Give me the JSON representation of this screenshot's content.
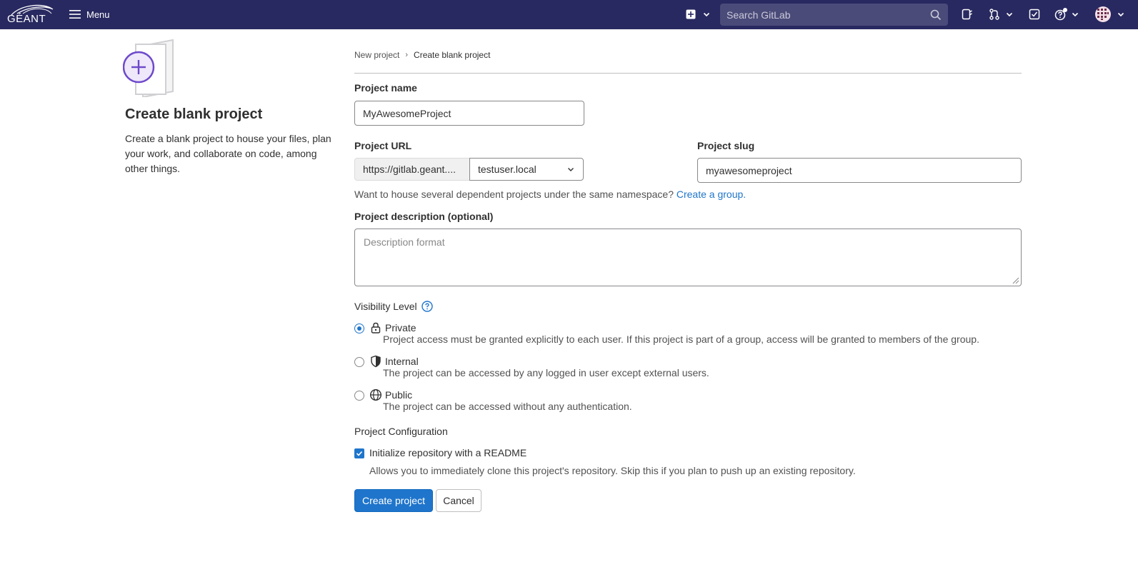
{
  "navbar": {
    "logo_text": "GÉANT",
    "menu_label": "Menu",
    "search_placeholder": "Search GitLab",
    "icons": [
      "plus-square-icon",
      "search-icon",
      "issues-icon",
      "merge-request-icon",
      "todo-icon",
      "help-icon",
      "avatar"
    ]
  },
  "left": {
    "title": "Create blank project",
    "description": "Create a blank project to house your files, plan your work, and collaborate on code, among other things."
  },
  "breadcrumb": {
    "parent": "New project",
    "separator": "›",
    "current": "Create blank project"
  },
  "form": {
    "project_name_label": "Project name",
    "project_name_value": "MyAwesomeProject",
    "project_url_label": "Project URL",
    "url_prefix": "https://gitlab.geant....",
    "namespace": "testuser.local",
    "project_slug_label": "Project slug",
    "project_slug_value": "myawesomeproject",
    "namespace_help_prefix": "Want to house several dependent projects under the same namespace? ",
    "namespace_help_link": "Create a group.",
    "description_label": "Project description (optional)",
    "description_placeholder": "Description format",
    "visibility_label": "Visibility Level",
    "visibility": [
      {
        "name": "Private",
        "desc": "Project access must be granted explicitly to each user. If this project is part of a group, access will be granted to members of the group.",
        "icon": "lock-icon",
        "checked": true
      },
      {
        "name": "Internal",
        "desc": "The project can be accessed by any logged in user except external users.",
        "icon": "shield-icon",
        "checked": false
      },
      {
        "name": "Public",
        "desc": "The project can be accessed without any authentication.",
        "icon": "globe-icon",
        "checked": false
      }
    ],
    "config_label": "Project Configuration",
    "readme_label": "Initialize repository with a README",
    "readme_help": "Allows you to immediately clone this project's repository. Skip this if you plan to push up an existing repository.",
    "readme_checked": true,
    "create_button": "Create project",
    "cancel_button": "Cancel"
  },
  "colors": {
    "navbar": "#292961",
    "primary": "#1f75cb",
    "link": "#1f75cb"
  }
}
